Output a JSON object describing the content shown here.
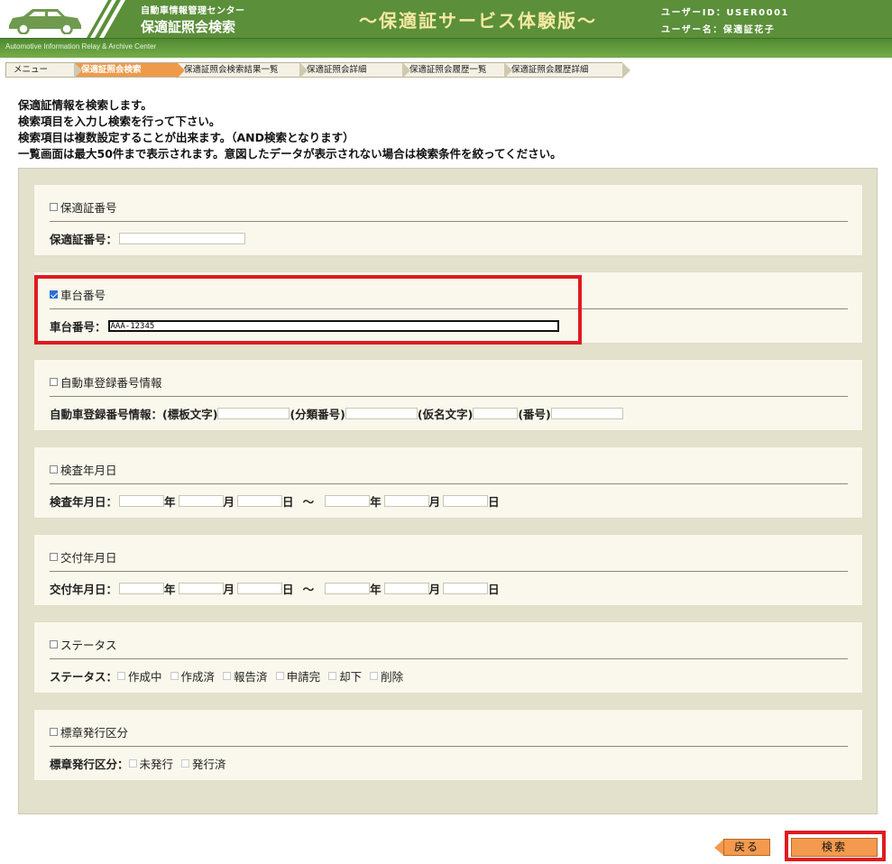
{
  "header": {
    "org_name": "自動車情報管理センター",
    "page_name": "保適証照会検索",
    "service_title": "～保適証サービス体験版～",
    "user_id": "ユーザーID：USER0001",
    "user_name": "ユーザー名：保適証花子",
    "subtitle": "Automotive Information Relay & Archive Center"
  },
  "breadcrumbs": [
    {
      "label": "メニュー"
    },
    {
      "label": "保適証照会検索"
    },
    {
      "label": "保適証照会検索結果一覧"
    },
    {
      "label": "保適証照会詳細"
    },
    {
      "label": "保適証照会履歴一覧"
    },
    {
      "label": "保適証照会履歴詳細"
    }
  ],
  "intro": [
    "保適証情報を検索します。",
    "検索項目を入力し検索を行って下さい。",
    "検索項目は複数設定することが出来ます。（AND検索となります）",
    "一覧画面は最大50件まで表示されます。意図したデータが表示されない場合は検索条件を絞ってください。"
  ],
  "sections": {
    "cert_no": {
      "title": "保適証番号",
      "checked": false,
      "label": "保適証番号：",
      "value": ""
    },
    "chassis_no": {
      "title": "車台番号",
      "checked": true,
      "label": "車台番号：",
      "value": "AAA-12345"
    },
    "registration": {
      "title": "自動車登録番号情報",
      "checked": false,
      "label": "自動車登録番号情報：",
      "parts": [
        "(標板文字)",
        "(分類番号)",
        "(仮名文字)",
        "(番号)"
      ]
    },
    "inspection_date": {
      "title": "検査年月日",
      "checked": false,
      "label": "検査年月日：",
      "year": "年",
      "month": "月",
      "day": "日",
      "tilde": "～"
    },
    "issue_date": {
      "title": "交付年月日",
      "checked": false,
      "label": "交付年月日：",
      "year": "年",
      "month": "月",
      "day": "日",
      "tilde": "～"
    },
    "status": {
      "title": "ステータス",
      "checked": false,
      "label": "ステータス：",
      "options": [
        "作成中",
        "作成済",
        "報告済",
        "申請完",
        "却下",
        "削除"
      ]
    },
    "badge": {
      "title": "標章発行区分",
      "checked": false,
      "label": "標章発行区分：",
      "options": [
        "未発行",
        "発行済"
      ]
    }
  },
  "buttons": {
    "back": "戻る",
    "search": "検索"
  },
  "colors": {
    "header_green": "#5b8f3a",
    "accent_orange": "#f39a4e",
    "highlight_red": "#e01a22",
    "panel_bg": "#e3e0cc"
  }
}
